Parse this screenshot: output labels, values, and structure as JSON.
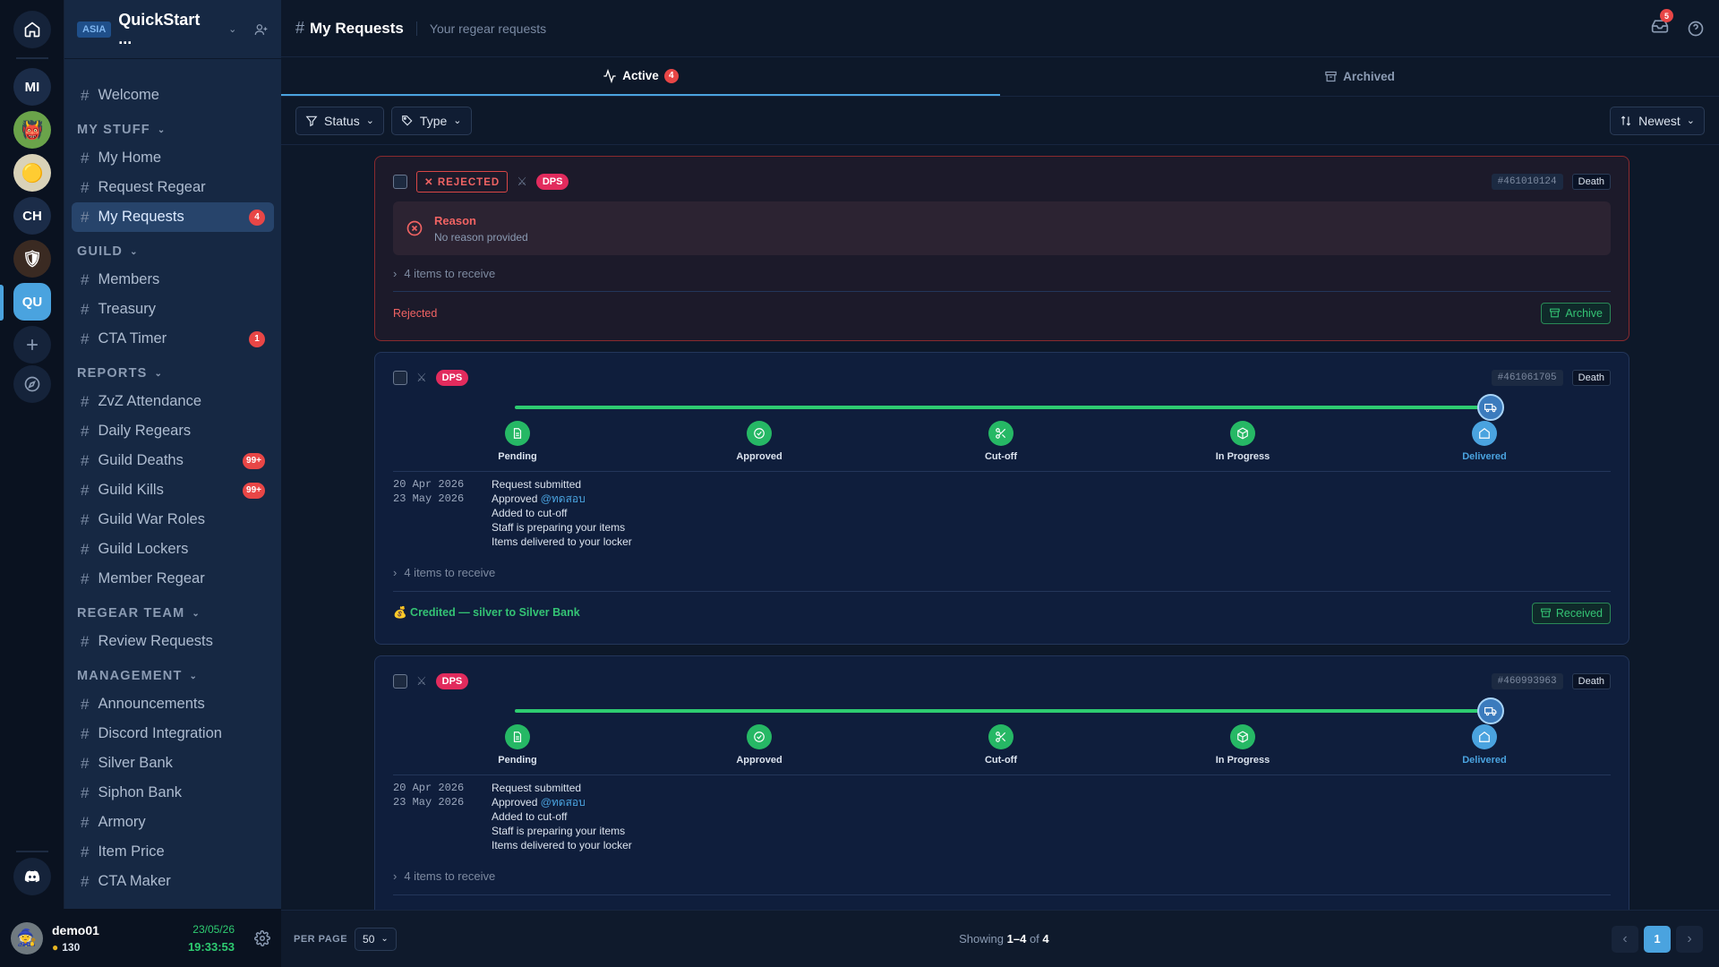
{
  "rail": {
    "home": "home-icon",
    "servers": [
      {
        "label": "MI"
      },
      {
        "label": ""
      },
      {
        "label": ""
      },
      {
        "label": "CH"
      },
      {
        "label": ""
      },
      {
        "label": "QU"
      }
    ]
  },
  "guild": {
    "region": "ASIA",
    "name": "QuickStart ..."
  },
  "nav": {
    "welcome": "Welcome",
    "my_stuff": {
      "title": "MY STUFF",
      "items": [
        {
          "label": "My Home"
        },
        {
          "label": "Request Regear"
        },
        {
          "label": "My Requests",
          "badge": "4"
        }
      ]
    },
    "guild": {
      "title": "GUILD",
      "items": [
        {
          "label": "Members"
        },
        {
          "label": "Treasury"
        },
        {
          "label": "CTA Timer",
          "badge": "1"
        }
      ]
    },
    "reports": {
      "title": "REPORTS",
      "items": [
        {
          "label": "ZvZ Attendance"
        },
        {
          "label": "Daily Regears"
        },
        {
          "label": "Guild Deaths",
          "badge": "99+"
        },
        {
          "label": "Guild Kills",
          "badge": "99+"
        },
        {
          "label": "Guild War Roles"
        },
        {
          "label": "Guild Lockers"
        },
        {
          "label": "Member Regear"
        }
      ]
    },
    "regear_team": {
      "title": "REGEAR TEAM",
      "items": [
        {
          "label": "Review Requests"
        }
      ]
    },
    "management": {
      "title": "MANAGEMENT",
      "items": [
        {
          "label": "Announcements"
        },
        {
          "label": "Discord Integration"
        },
        {
          "label": "Silver Bank"
        },
        {
          "label": "Siphon Bank"
        },
        {
          "label": "Armory"
        },
        {
          "label": "Item Price"
        },
        {
          "label": "CTA Maker"
        }
      ]
    }
  },
  "user": {
    "name": "demo01",
    "coins": "130",
    "date": "23/05/26",
    "time": "19:33:53"
  },
  "header": {
    "title": "My Requests",
    "subtitle": "Your regear requests",
    "notif_count": "5"
  },
  "tabs": {
    "active": "Active",
    "active_count": "4",
    "archived": "Archived"
  },
  "filters": {
    "status": "Status",
    "type": "Type",
    "sort": "Newest"
  },
  "cards": [
    {
      "status": "✕ REJECTED",
      "role": "DPS",
      "id": "#461010124",
      "type": "Death",
      "reason_title": "Reason",
      "reason_text": "No reason provided",
      "items": "4 items to receive",
      "footer": "Rejected",
      "action": "Archive"
    },
    {
      "role": "DPS",
      "id": "#461061705",
      "type": "Death",
      "steps": [
        "Pending",
        "Approved",
        "Cut-off",
        "In Progress",
        "Delivered"
      ],
      "dates": [
        "20 Apr 2026",
        "23 May 2026"
      ],
      "events": [
        "Request submitted",
        "Approved ",
        "Added to cut-off",
        "Staff is preparing your items",
        "Items delivered to your locker"
      ],
      "approver": "@ทดสอบ",
      "items": "4 items to receive",
      "footer": "💰 Credited — silver to Silver Bank",
      "action": "Received"
    },
    {
      "role": "DPS",
      "id": "#460993963",
      "type": "Death",
      "steps": [
        "Pending",
        "Approved",
        "Cut-off",
        "In Progress",
        "Delivered"
      ],
      "dates": [
        "20 Apr 2026",
        "23 May 2026"
      ],
      "events": [
        "Request submitted",
        "Approved ",
        "Added to cut-off",
        "Staff is preparing your items",
        "Items delivered to your locker"
      ],
      "approver": "@ทดสอบ",
      "items": "4 items to receive"
    }
  ],
  "pager": {
    "per_page_label": "PER PAGE",
    "per_page": "50",
    "showing": "Showing ",
    "range": "1–4",
    "of": " of ",
    "total": "4",
    "page": "1"
  }
}
